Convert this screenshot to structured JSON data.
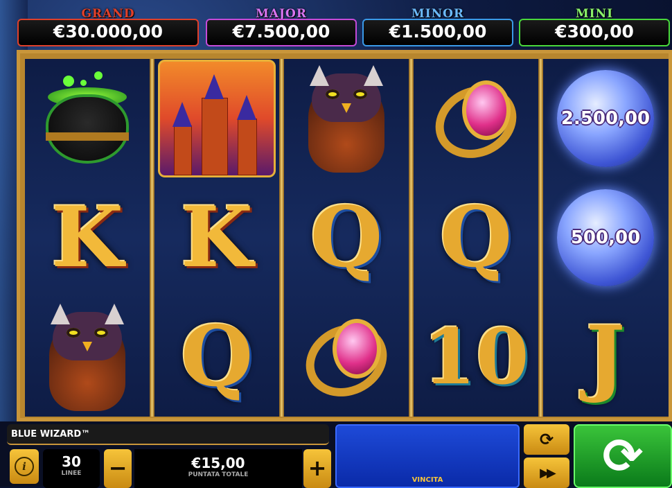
{
  "jackpots": [
    {
      "label": "GRAND",
      "value": "€30.000,00",
      "color": "#e0402a"
    },
    {
      "label": "MAJOR",
      "value": "€7.500,00",
      "color": "#c64ad8"
    },
    {
      "label": "MINOR",
      "value": "€1.500,00",
      "color": "#3a9ae8"
    },
    {
      "label": "MINI",
      "value": "€300,00",
      "color": "#4ad83a"
    }
  ],
  "reels": [
    [
      "cauldron",
      "K",
      "owl"
    ],
    [
      "castle",
      "K",
      "Q"
    ],
    [
      "owl",
      "Q",
      "ring"
    ],
    [
      "ring",
      "Q",
      "10"
    ],
    [
      "orb",
      "orb",
      "J"
    ]
  ],
  "orbs": {
    "top": "2.500,00",
    "middle": "500,00"
  },
  "letters": {
    "k1": "K",
    "k2": "K",
    "q1": "Q",
    "q2": "Q",
    "q3": "Q",
    "ten": "10",
    "j": "J"
  },
  "game_title": "BLUE WIZARD™",
  "info_icon": "i",
  "lines": {
    "value": "30",
    "label": "LINEE"
  },
  "stake": {
    "value": "€15,00",
    "label": "PUNTATA TOTALE",
    "minus": "−",
    "plus": "+"
  },
  "win": {
    "label": "VINCITA"
  },
  "controls": {
    "autoplay_icon": "⟳",
    "turbo_icon": "▶▶",
    "spin_icon": "⟳"
  }
}
